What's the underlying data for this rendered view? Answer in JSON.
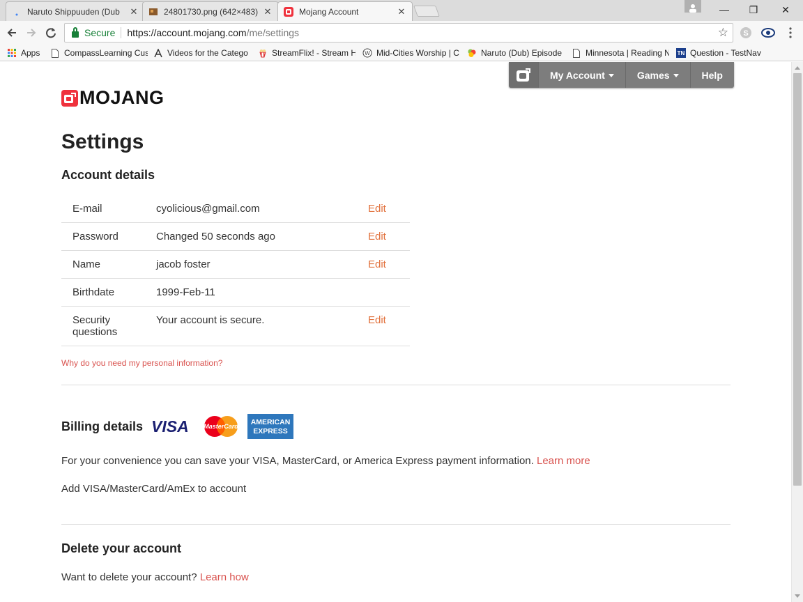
{
  "browser": {
    "tabs": [
      {
        "title": "Naruto Shippuuden (Dub",
        "close": "✕",
        "state": "inactive"
      },
      {
        "title": "24801730.png (642×483)",
        "close": "✕",
        "state": "inactive"
      },
      {
        "title": "Mojang Account",
        "close": "✕",
        "state": "active"
      }
    ],
    "window_controls": {
      "minimize": "—",
      "restore": "❐",
      "close": "✕"
    },
    "secure_label": "Secure",
    "url_base": "https://account.mojang.com",
    "url_path": "/me/settings",
    "bookmarks": [
      {
        "label": "Apps",
        "icon": "apps-grid-icon"
      },
      {
        "label": "CompassLearning Cus",
        "icon": "page-icon"
      },
      {
        "label": "Videos for the Catego",
        "icon": "letter-a-icon"
      },
      {
        "label": "StreamFlix! - Stream H",
        "icon": "popcorn-icon"
      },
      {
        "label": "Mid-Cities Worship | C",
        "icon": "w-circle-icon"
      },
      {
        "label": "Naruto (Dub) Episode",
        "icon": "leaf-icon"
      },
      {
        "label": "Minnesota | Reading N",
        "icon": "page-icon"
      },
      {
        "label": "Question - TestNav",
        "icon": "tn-icon"
      }
    ],
    "tn_icon_text": "TN"
  },
  "site_nav": {
    "my_account": "My Account",
    "games": "Games",
    "help": "Help"
  },
  "brand": {
    "wordmark": "MOJANG"
  },
  "page": {
    "title": "Settings",
    "account_details": {
      "heading": "Account details",
      "rows": [
        {
          "key": "E-mail",
          "value": "cyolicious@gmail.com",
          "action": "Edit"
        },
        {
          "key": "Password",
          "value": "Changed 50 seconds ago",
          "action": "Edit"
        },
        {
          "key": "Name",
          "value": "jacob foster",
          "action": "Edit"
        },
        {
          "key": "Birthdate",
          "value": "1999-Feb-11",
          "action": ""
        },
        {
          "key": "Security questions",
          "value": "Your account is secure.",
          "action": "Edit"
        }
      ],
      "why_link": "Why do you need my personal information?"
    },
    "billing": {
      "heading": "Billing details",
      "cards": {
        "visa": "VISA",
        "mastercard": "MasterCard",
        "amex_line1": "AMERICAN",
        "amex_line2": "EXPRESS"
      },
      "description": "For your convenience you can save your VISA, MasterCard, or America Express payment information.",
      "learn_more": "Learn more",
      "add_link": "Add VISA/MasterCard/AmEx to account"
    },
    "delete": {
      "heading": "Delete your account",
      "question": "Want to delete your account?",
      "learn_how": "Learn how"
    }
  },
  "colors": {
    "accent_orange": "#e2713c",
    "link_red": "#d9534f",
    "brand_red": "#ef323d",
    "nav_gray": "#7d7d7d"
  }
}
